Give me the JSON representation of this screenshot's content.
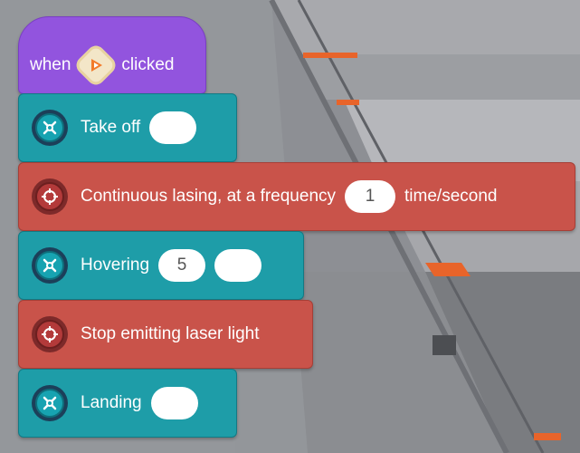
{
  "hat_block": {
    "word_when": "when",
    "word_clicked": "clicked",
    "icon": "green-flag-play-icon"
  },
  "blocks": [
    {
      "type": "teal",
      "label": "Take off",
      "icon": "drone-icon",
      "input_value": ""
    },
    {
      "type": "red",
      "label": "Continuous lasing, at a frequency",
      "icon": "laser-target-icon",
      "input_value": "1",
      "suffix": "time/second"
    },
    {
      "type": "teal",
      "label": "Hovering",
      "icon": "drone-icon",
      "input_value": "5",
      "input2_value": ""
    },
    {
      "type": "red",
      "label": "Stop emitting laser light",
      "icon": "laser-target-icon"
    },
    {
      "type": "teal",
      "label": "Landing",
      "icon": "drone-icon",
      "input_value": ""
    }
  ],
  "colors": {
    "hat": "#9254de",
    "motion_block": "#1e9da8",
    "laser_block": "#c9534a",
    "input_bg": "#ffffff"
  }
}
